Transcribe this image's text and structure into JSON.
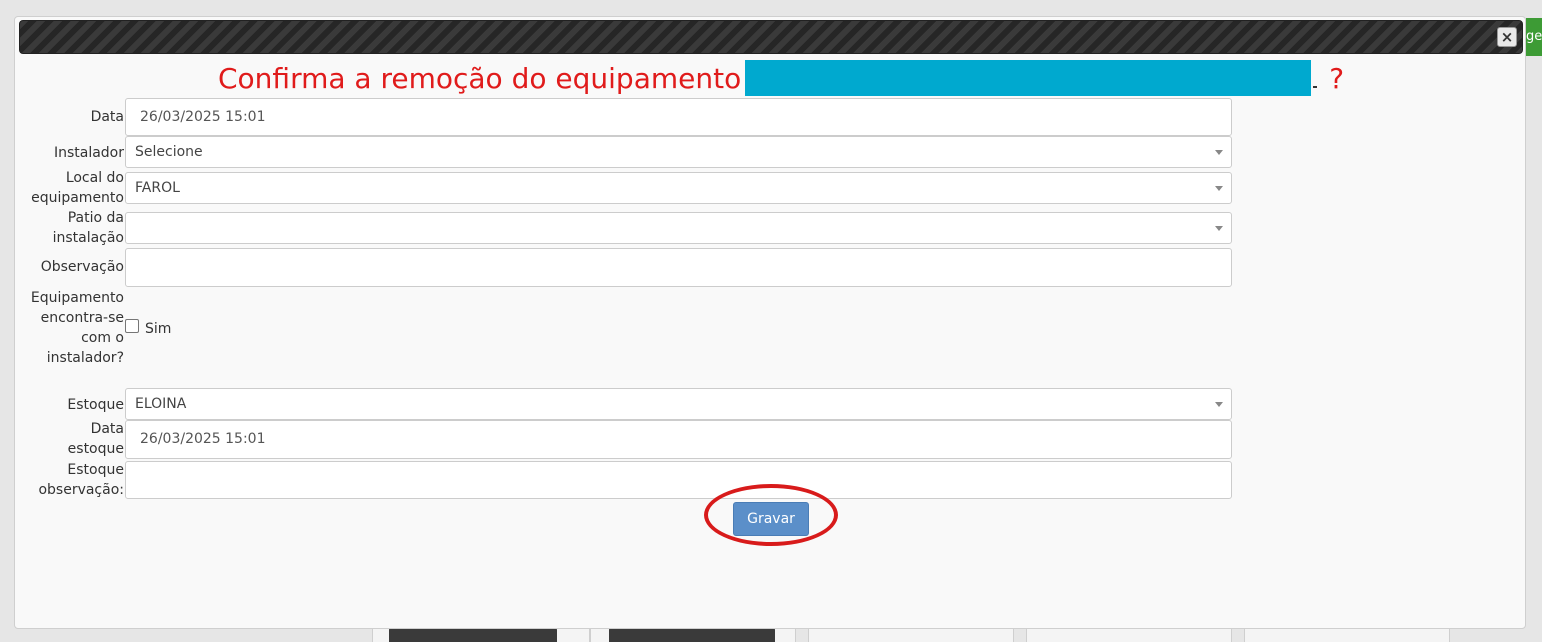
{
  "title": {
    "text": "Confirma a remoção do equipamento",
    "suffix": "?"
  },
  "close_icon": "×",
  "side_tab_text": "ger",
  "form": {
    "data": {
      "label": "Data",
      "value": "26/03/2025 15:01"
    },
    "instalador": {
      "label": "Instalador",
      "value": "Selecione"
    },
    "local": {
      "label_line1": "Local do",
      "label_line2": "equipamento",
      "value": "FAROL"
    },
    "patio": {
      "label_line1": "Patio da",
      "label_line2": "instalação",
      "value": ""
    },
    "observacao": {
      "label": "Observação",
      "value": ""
    },
    "com_instalador": {
      "label_line1": "Equipamento",
      "label_line2": "encontra-se",
      "label_line3": "com o",
      "label_line4": "instalador?",
      "checkbox_label": "Sim",
      "checked": false
    },
    "estoque": {
      "label": "Estoque",
      "value": "ELOINA"
    },
    "data_estoque": {
      "label_line1": "Data",
      "label_line2": "estoque",
      "value": "26/03/2025 15:01"
    },
    "estoque_observacao": {
      "label_line1": "Estoque",
      "label_line2": "observação:",
      "value": ""
    }
  },
  "buttons": {
    "save": "Gravar"
  },
  "colors": {
    "title_red": "#e01b1b",
    "redaction": "#00a9cf",
    "button_blue": "#5b8fc9",
    "highlight_ring": "#d81b1b"
  }
}
